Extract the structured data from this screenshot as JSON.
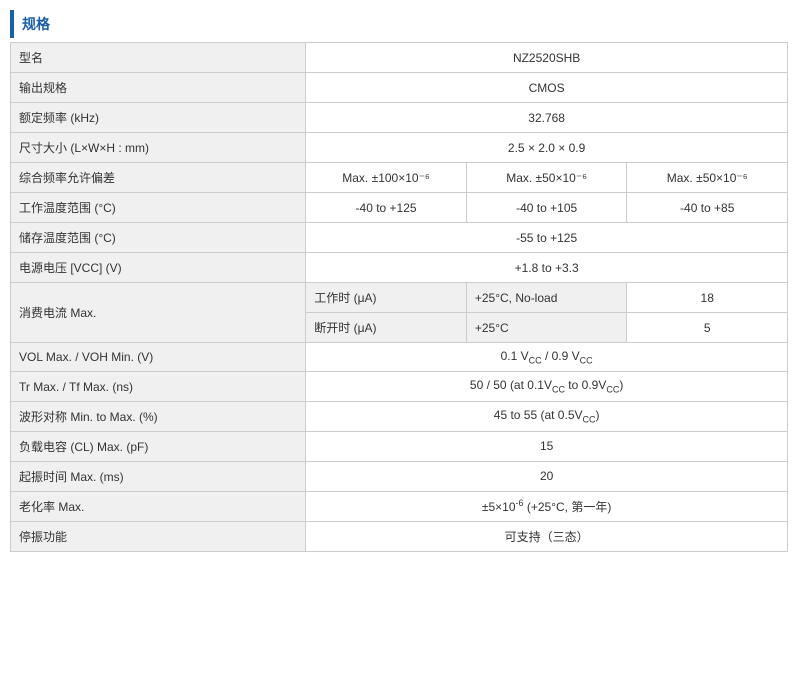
{
  "section_title": "规格",
  "rows": [
    {
      "id": "model",
      "label": "型名",
      "type": "single",
      "value": "NZ2520SHB"
    },
    {
      "id": "output_spec",
      "label": "输出规格",
      "type": "single",
      "value": "CMOS"
    },
    {
      "id": "freq",
      "label": "额定频率 (kHz)",
      "type": "single",
      "value": "32.768"
    },
    {
      "id": "dimensions",
      "label": "尺寸大小 (L×W×H : mm)",
      "type": "single",
      "value": "2.5 × 2.0 × 0.9"
    },
    {
      "id": "freq_tolerance",
      "label": "综合频率允许偏差",
      "type": "triple",
      "values": [
        "Max. ±100×10⁻⁶",
        "Max. ±50×10⁻⁶",
        "Max. ±50×10⁻⁶"
      ]
    },
    {
      "id": "op_temp",
      "label": "工作温度范围 (°C)",
      "type": "triple",
      "values": [
        "-40 to +125",
        "-40 to +105",
        "-40 to +85"
      ]
    },
    {
      "id": "storage_temp",
      "label": "储存温度范围 (°C)",
      "type": "single",
      "value": "-55 to +125"
    },
    {
      "id": "supply_voltage",
      "label": "电源电压 [VCC] (V)",
      "type": "single",
      "value": "+1.8 to +3.3"
    },
    {
      "id": "current_op",
      "label_main": "消费电流 Max.",
      "label_sub": "工作时 (μA)",
      "label_sub2": "断开时 (μA)",
      "label_cond": "+25°C, No-load",
      "label_cond2": "+25°C",
      "type": "dual_sub",
      "value1": "18",
      "value2": "5"
    },
    {
      "id": "vol_voh",
      "label": "VOL Max. / VOH Min. (V)",
      "type": "single_html",
      "value": "0.1 V<sub>CC</sub> / 0.9 V<sub>CC</sub>"
    },
    {
      "id": "tr_tf",
      "label": "Tr Max. / Tf Max. (ns)",
      "type": "single_html",
      "value": "50 / 50 (at 0.1V<sub>CC</sub> to 0.9V<sub>CC</sub>)"
    },
    {
      "id": "symmetry",
      "label": "波形对称 Min. to Max. (%)",
      "type": "single_html",
      "value": "45 to 55 (at 0.5V<sub>CC</sub>)"
    },
    {
      "id": "load_cap",
      "label": "负载电容 (CL) Max. (pF)",
      "type": "single",
      "value": "15"
    },
    {
      "id": "start_time",
      "label": "起振时间 Max. (ms)",
      "type": "single",
      "value": "20"
    },
    {
      "id": "aging",
      "label": "老化率 Max.",
      "type": "single_html",
      "value": "±5×10<sup>-6</sup> (+25°C, 第一年)"
    },
    {
      "id": "standby",
      "label": "停振功能",
      "type": "single",
      "value": "可支持（三态）"
    }
  ]
}
